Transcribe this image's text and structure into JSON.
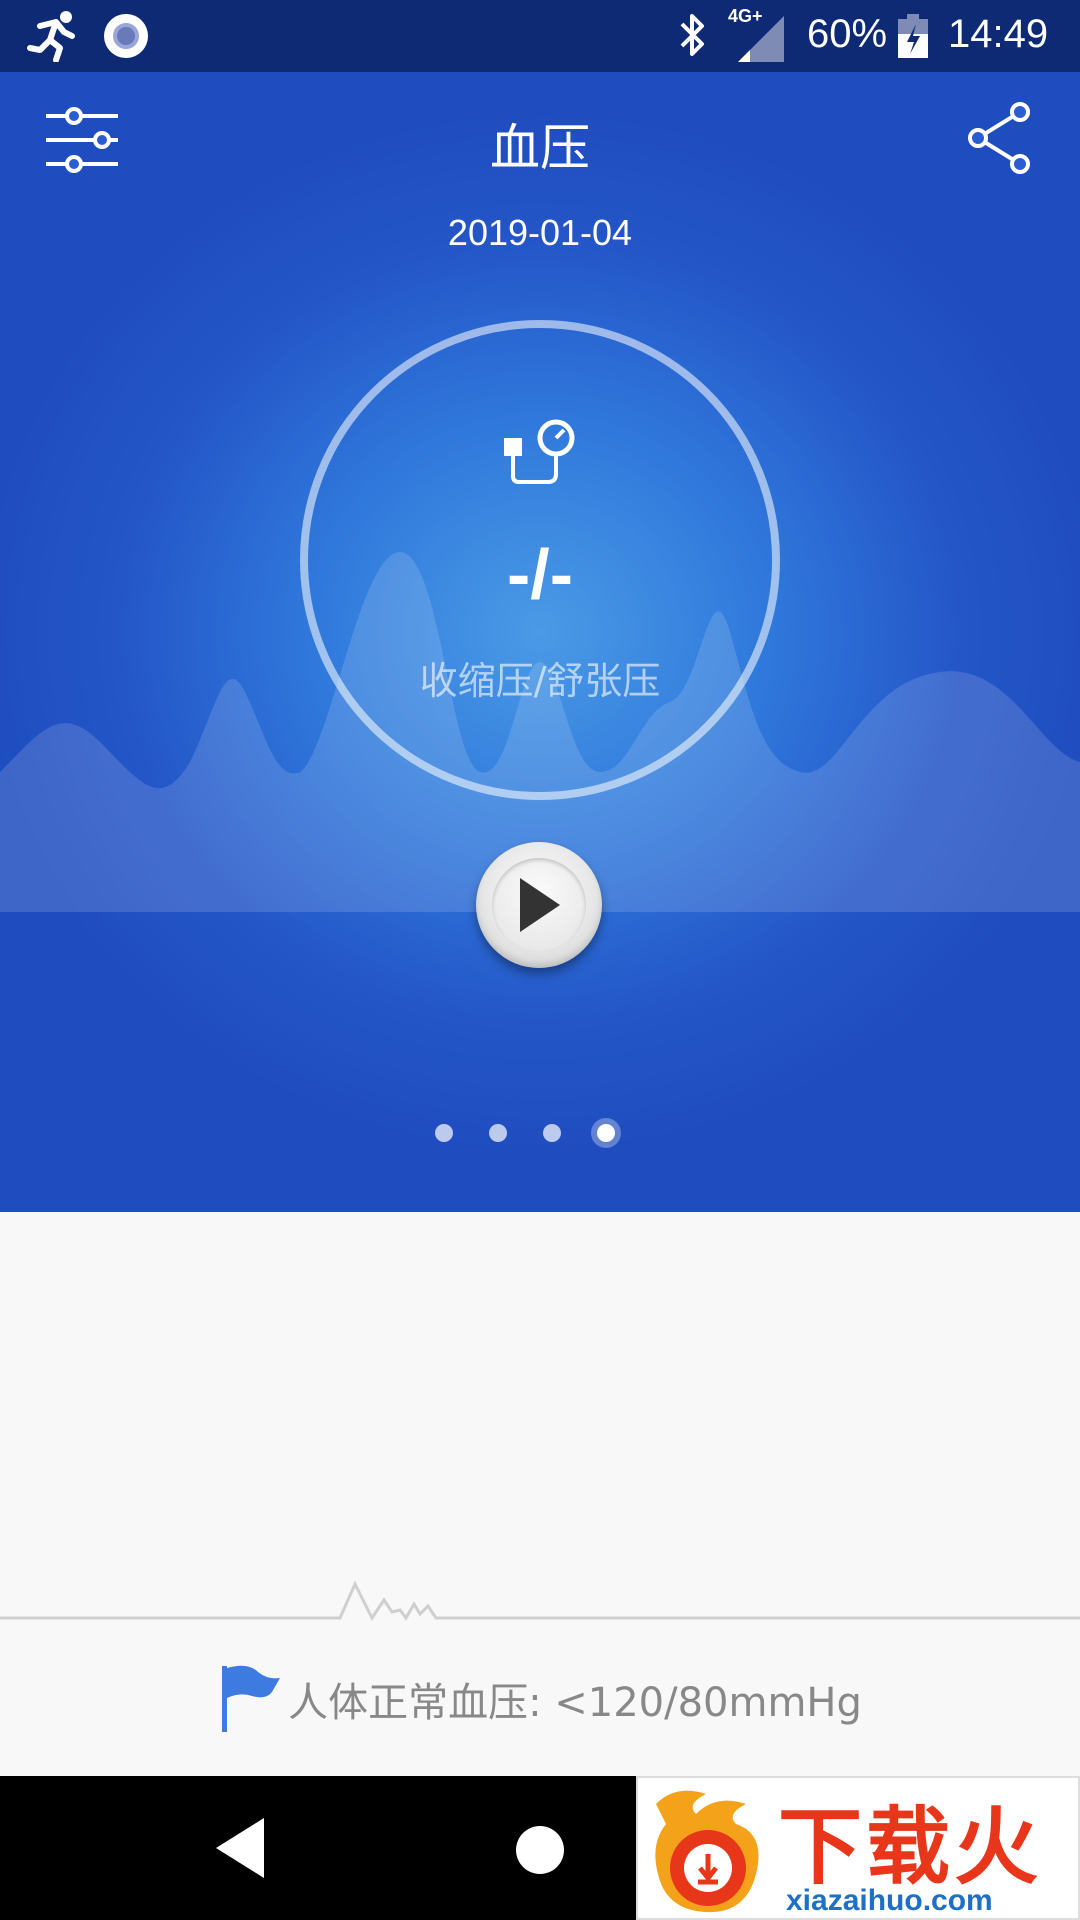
{
  "status_bar": {
    "network": "4G+",
    "battery_percent": "60%",
    "time": "14:49"
  },
  "header": {
    "title": "血压",
    "date": "2019-01-04"
  },
  "measurement": {
    "reading": "-/-",
    "label": "收缩压/舒张压"
  },
  "pager": {
    "count": 4,
    "active_index": 3
  },
  "footer": {
    "normal_range": "人体正常血压: <120/80mmHg"
  },
  "watermark": {
    "brand": "下载火",
    "domain": "xiazaihuo.com"
  },
  "colors": {
    "hero_blue": "#2456c8",
    "status_bar": "#0e2a75",
    "flag_blue": "#3d7be0"
  }
}
